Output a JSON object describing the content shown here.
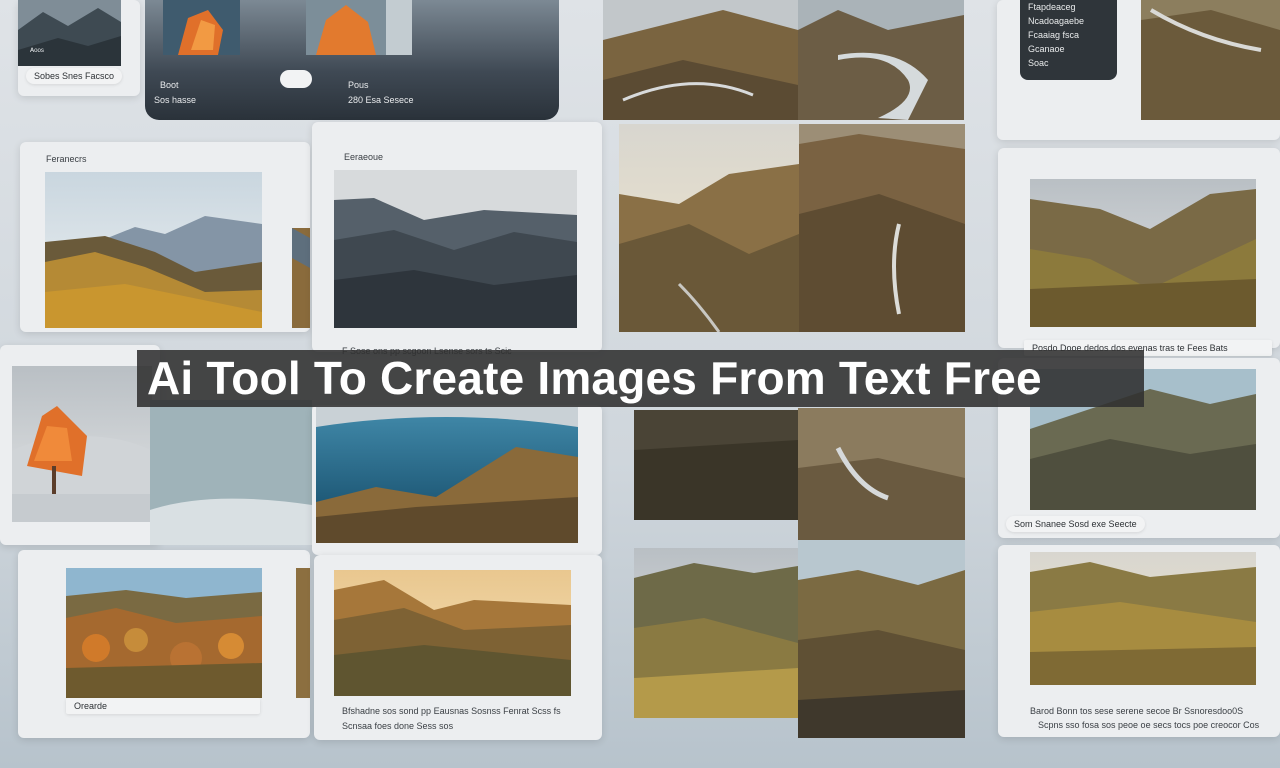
{
  "banner": {
    "title": "Ai Tool To Create Images From Text Free"
  },
  "captions": {
    "top_left_card": "Sobes Snes Facsco",
    "top_left_small": "ᴬᵒᵒˢ",
    "dark_panel_left_title": "Boot",
    "dark_panel_left_sub": "Sos hasse",
    "dark_panel_right_title": "Pous",
    "dark_panel_right_sub": "280 Esa Sesece",
    "top_right_text": [
      "Ftapdeaceg",
      "Ncadoagaebe",
      "Fcaaiag fsca",
      "Gcanaoe",
      "Soac"
    ],
    "left_card_title": "Feranecrs",
    "mid_card_title": "Eeraeoue",
    "mid_card_caption": "F Sose ons pp scgoon Lsense sors ts Scic",
    "right_card_caption": "Posdo Dooe dedos dos evenas tras te Fees Bats",
    "right_pill": "Som Snanee Sosd exe Seecte",
    "bottom_left_caption": "Orearde",
    "bottom_mid_caption_1": "Bfshadne sos sond pp Eausnas Sosnss Fenrat Scss fs",
    "bottom_mid_caption_2": "Scnsaa foes done Sess sos",
    "bottom_right_caption_1": "Barod Bonn tos sese serene secoe Br Ssnoresdoo0S",
    "bottom_right_caption_2": "Scpns sso fosa sos peoe oe secs tocs poe creocor Cos"
  },
  "colors": {
    "banner_bg": "#303030",
    "banner_text": "#ffffff",
    "autumn": "#e0702a"
  }
}
